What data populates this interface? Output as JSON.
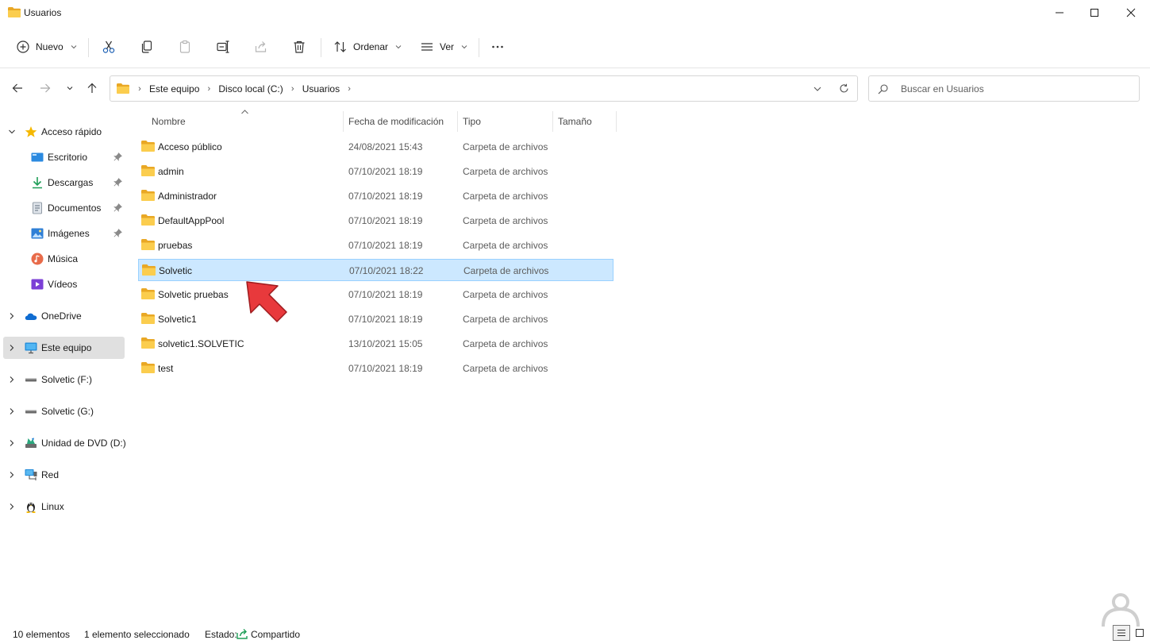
{
  "window": {
    "title": "Usuarios",
    "controls": [
      "minimize",
      "maximize",
      "close"
    ]
  },
  "toolbar": {
    "new_label": "Nuevo",
    "sort_label": "Ordenar",
    "view_label": "Ver",
    "icons": [
      "cut-icon",
      "copy-icon",
      "paste-icon",
      "rename-icon",
      "share-icon",
      "delete-icon",
      "more-icon"
    ]
  },
  "address": {
    "crumbs": [
      "Este equipo",
      "Disco local (C:)",
      "Usuarios"
    ]
  },
  "search": {
    "placeholder": "Buscar en Usuarios"
  },
  "sidebar": {
    "items": [
      {
        "label": "Acceso rápido",
        "icon": "star-icon",
        "level": 0,
        "expanded": true
      },
      {
        "label": "Escritorio",
        "icon": "desktop-icon",
        "level": 1,
        "pinned": true
      },
      {
        "label": "Descargas",
        "icon": "download-icon",
        "level": 1,
        "pinned": true
      },
      {
        "label": "Documentos",
        "icon": "document-icon",
        "level": 1,
        "pinned": true
      },
      {
        "label": "Imágenes",
        "icon": "image-icon",
        "level": 1,
        "pinned": true
      },
      {
        "label": "Música",
        "icon": "music-icon",
        "level": 1
      },
      {
        "label": "Vídeos",
        "icon": "video-icon",
        "level": 1
      },
      {
        "label": "OneDrive",
        "icon": "cloud-icon",
        "level": 0
      },
      {
        "label": "Este equipo",
        "icon": "computer-icon",
        "level": 0,
        "selected": true
      },
      {
        "label": "Solvetic (F:)",
        "icon": "drive-icon",
        "level": 0
      },
      {
        "label": "Solvetic (G:)",
        "icon": "drive-icon",
        "level": 0
      },
      {
        "label": "Unidad de DVD (D:)",
        "icon": "dvd-icon",
        "level": 0
      },
      {
        "label": "Red",
        "icon": "network-icon",
        "level": 0
      },
      {
        "label": "Linux",
        "icon": "linux-icon",
        "level": 0
      }
    ]
  },
  "columns": {
    "name": "Nombre",
    "date": "Fecha de modificación",
    "type": "Tipo",
    "size": "Tamaño"
  },
  "files": [
    {
      "name": "Acceso público",
      "date": "24/08/2021 15:43",
      "type": "Carpeta de archivos"
    },
    {
      "name": "admin",
      "date": "07/10/2021 18:19",
      "type": "Carpeta de archivos"
    },
    {
      "name": "Administrador",
      "date": "07/10/2021 18:19",
      "type": "Carpeta de archivos"
    },
    {
      "name": "DefaultAppPool",
      "date": "07/10/2021 18:19",
      "type": "Carpeta de archivos"
    },
    {
      "name": "pruebas",
      "date": "07/10/2021 18:19",
      "type": "Carpeta de archivos"
    },
    {
      "name": "Solvetic",
      "date": "07/10/2021 18:22",
      "type": "Carpeta de archivos",
      "selected": true
    },
    {
      "name": "Solvetic pruebas",
      "date": "07/10/2021 18:19",
      "type": "Carpeta de archivos"
    },
    {
      "name": "Solvetic1",
      "date": "07/10/2021 18:19",
      "type": "Carpeta de archivos"
    },
    {
      "name": "solvetic1.SOLVETIC",
      "date": "13/10/2021 15:05",
      "type": "Carpeta de archivos"
    },
    {
      "name": "test",
      "date": "07/10/2021 18:19",
      "type": "Carpeta de archivos"
    }
  ],
  "status": {
    "count": "10 elementos",
    "selection": "1 elemento seleccionado",
    "state_label": "Estado:",
    "state_value": "Compartido"
  },
  "colors": {
    "folder": "#f8c547",
    "selection_bg": "#cce8ff",
    "selection_border": "#99d1ff",
    "accent": "#0067c0",
    "arrow": "#e8393c"
  }
}
